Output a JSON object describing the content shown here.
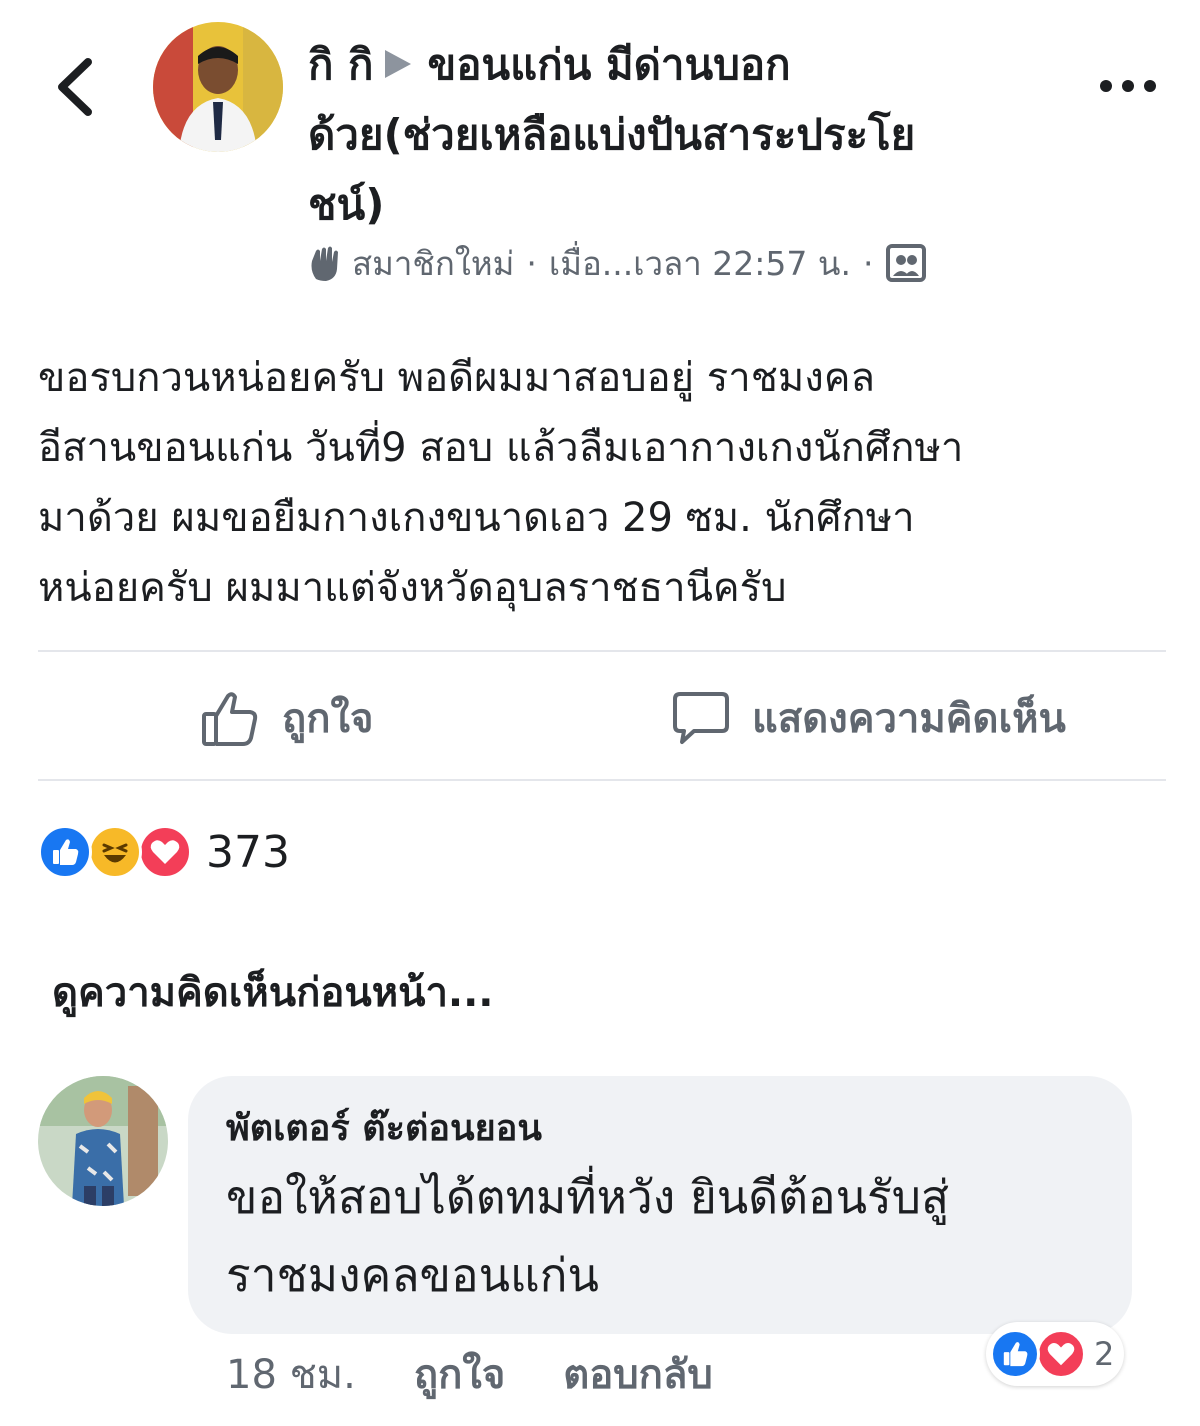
{
  "header": {
    "title_line1_prefix": "กิ กิ",
    "title_line1_suffix": "ขอนแก่น มีด่านบอก",
    "title_line2": "ด้วย(ช่วยเหลือแบ่งปันสาระประโย",
    "title_line3": "ชน์)",
    "badge": "สมาชิกใหม่",
    "separator": "·",
    "time": "เมื่อ...เวลา 22:57 น."
  },
  "post": {
    "lines": [
      "ขอรบกวนหน่อยครับ พอดีผมมาสอบอยู่ ราชมงคล",
      "อีสานขอนแก่น วันที่9 สอบ แล้วลืมเอากางเกงนักศึกษา",
      "มาด้วย ผมขอยืมกางเกงขนาดเอว 29 ซม. นักศึกษา",
      "หน่อยครับ ผมมาแต่จังหวัดอุบลราชธานีครับ"
    ]
  },
  "actions": {
    "like_label": "ถูกใจ",
    "comment_label": "แสดงความคิดเห็น"
  },
  "reactions": {
    "icons": [
      "like-reaction",
      "haha-reaction",
      "love-reaction"
    ],
    "count": "373"
  },
  "comments": {
    "view_previous": "ดูความคิดเห็นก่อนหน้า...",
    "items": [
      {
        "author": "พัตเตอร์ ต๊ะต่อนยอน",
        "text_lines": [
          "ขอให้สอบได้ตทมที่หวัง ยินดีต้อนรับสู่",
          "ราชมงคลขอนแก่น"
        ],
        "time": "18 ชม.",
        "like_label": "ถูกใจ",
        "reply_label": "ตอบกลับ",
        "reaction_count": "2"
      }
    ]
  },
  "colors": {
    "like_blue": "#1877f2",
    "love_red": "#f33e58",
    "haha_yellow": "#f7b928",
    "secondary_text": "#606770",
    "bubble_bg": "#f0f2f5"
  }
}
